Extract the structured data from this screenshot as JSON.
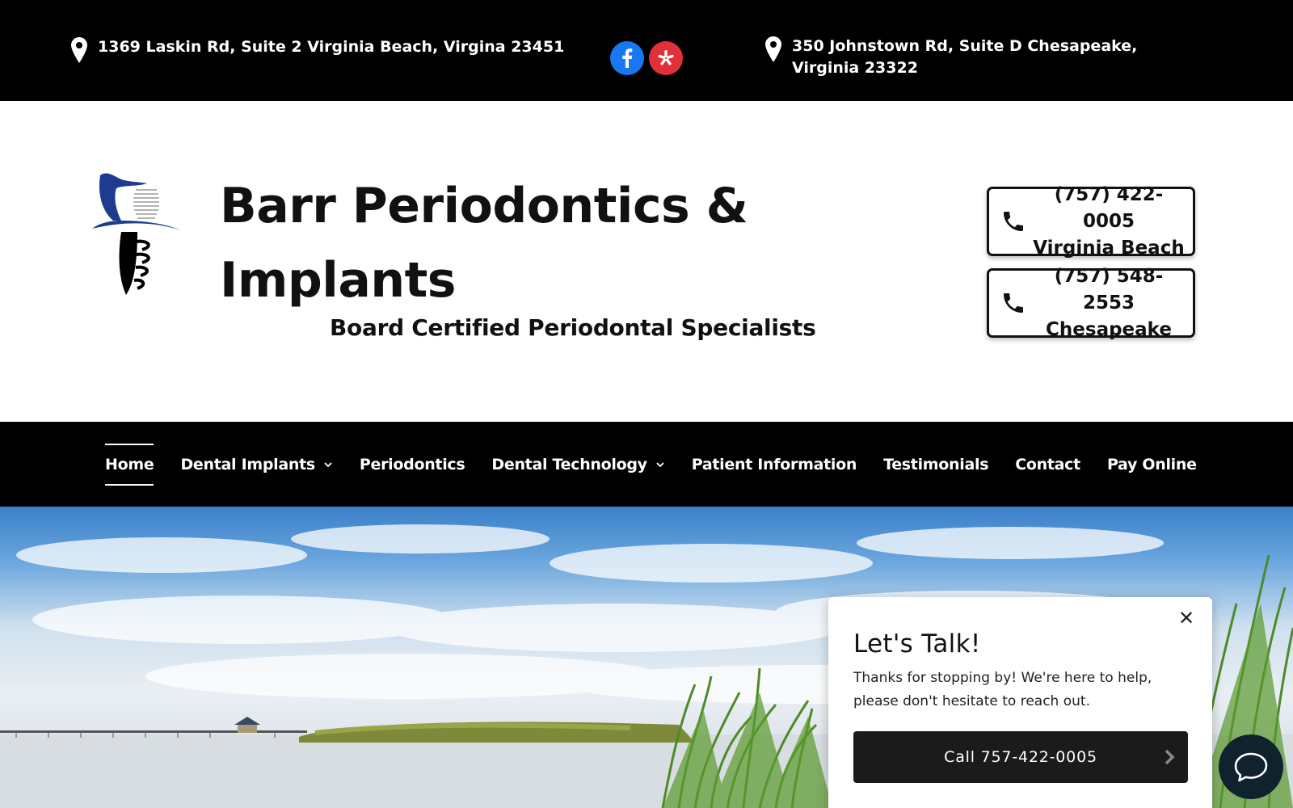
{
  "topbar": {
    "address_1": "1369 Laskin Rd, Suite 2 Virginia Beach, Virgina 23451",
    "address_2": "350 Johnstown Rd, Suite D Chesapeake, Virginia 23322",
    "social": [
      {
        "icon": "facebook-icon",
        "color": "#1877f2"
      },
      {
        "icon": "yelp-icon",
        "color": "#e0313a"
      }
    ]
  },
  "header": {
    "brand_title": "Barr Periodontics & Implants",
    "brand_subtitle": "Board Certified Periodontal Specialists",
    "phones": [
      {
        "number": "(757) 422-0005",
        "location": "Virginia Beach"
      },
      {
        "number": "(757) 548-2553",
        "location": "Chesapeake"
      }
    ]
  },
  "nav": {
    "items": [
      {
        "label": "Home",
        "active": true,
        "has_dropdown": false
      },
      {
        "label": "Dental Implants",
        "active": false,
        "has_dropdown": true
      },
      {
        "label": "Periodontics",
        "active": false,
        "has_dropdown": false
      },
      {
        "label": "Dental Technology",
        "active": false,
        "has_dropdown": true
      },
      {
        "label": "Patient Information",
        "active": false,
        "has_dropdown": false
      },
      {
        "label": "Testimonials",
        "active": false,
        "has_dropdown": false
      },
      {
        "label": "Contact",
        "active": false,
        "has_dropdown": false
      },
      {
        "label": "Pay Online",
        "active": false,
        "has_dropdown": false
      }
    ]
  },
  "chat": {
    "close_glyph": "✕",
    "title": "Let's Talk!",
    "message": "Thanks for stopping by! We're here to help, please don't hesitate to reach out.",
    "cta_label": "Call 757-422-0005"
  },
  "colors": {
    "topbar_bg": "#000000",
    "nav_bg": "#000000",
    "logo_blue": "#1f3b8f",
    "chat_cta_bg": "#1b1b1b",
    "chat_bubble_bg": "#10222e"
  }
}
